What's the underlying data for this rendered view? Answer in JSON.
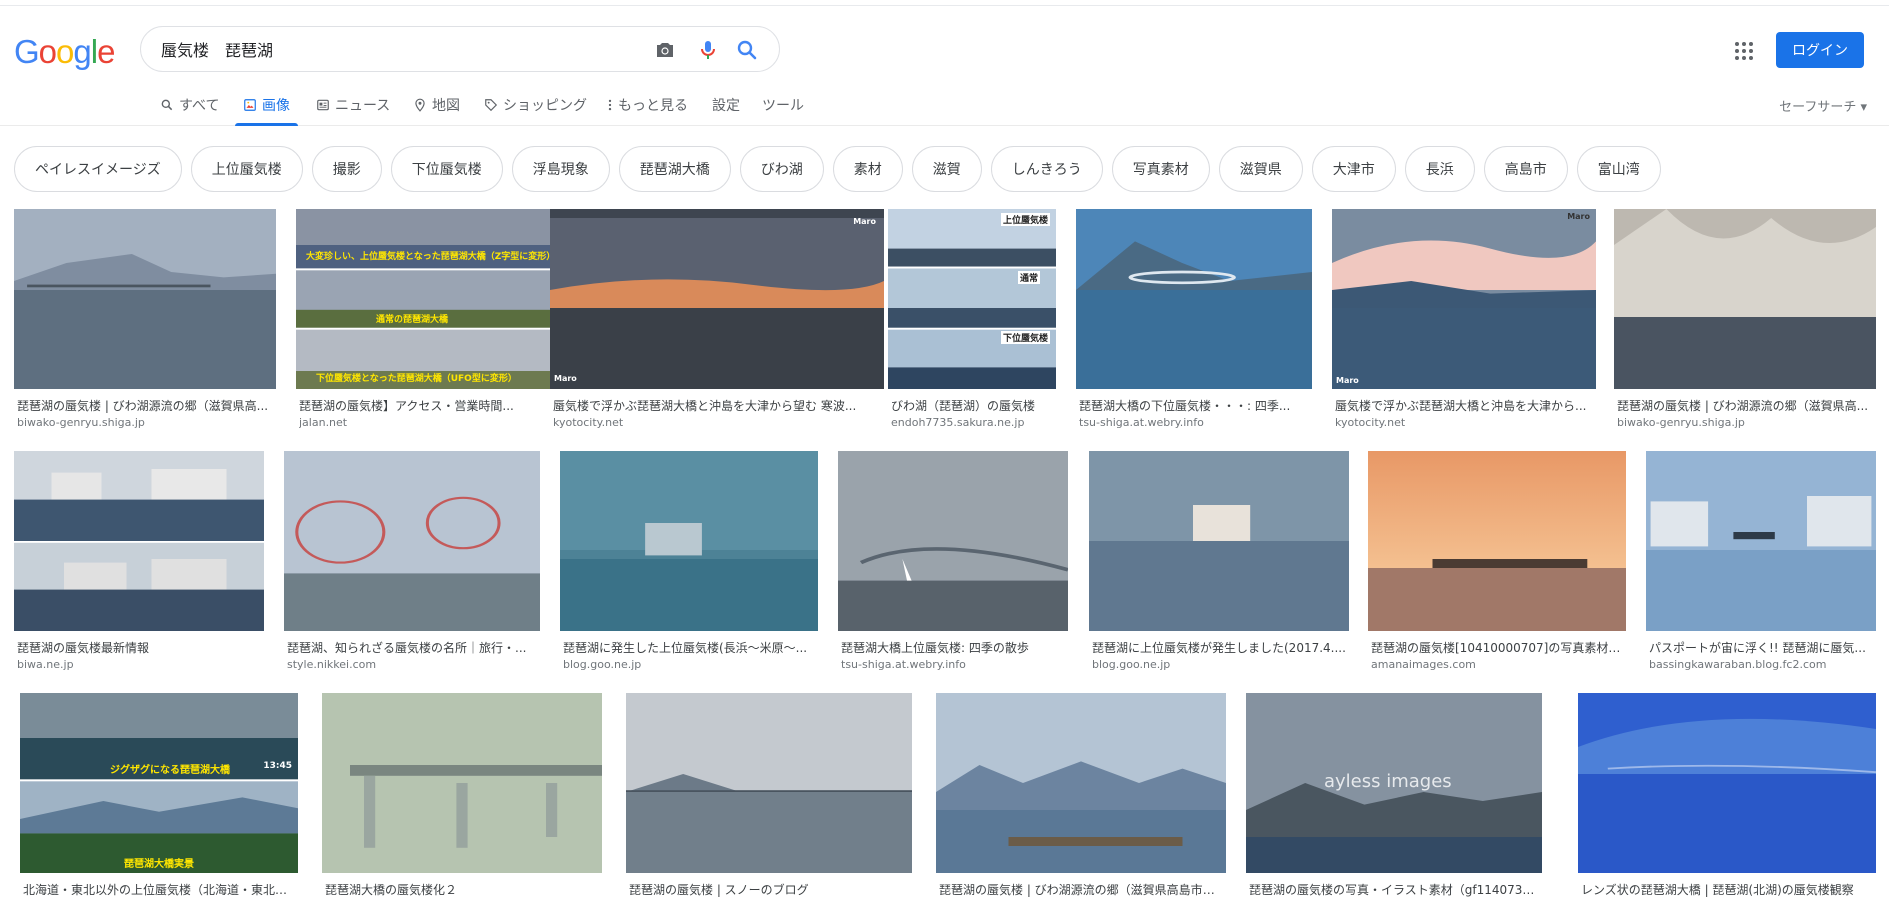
{
  "logo": "Google",
  "search": {
    "query": "蜃気楼　琵琶湖"
  },
  "header": {
    "login_label": "ログイン"
  },
  "tabs": [
    {
      "label": "すべて",
      "icon": "search-icon"
    },
    {
      "label": "画像",
      "icon": "image-icon",
      "active": true
    },
    {
      "label": "ニュース",
      "icon": "news-icon"
    },
    {
      "label": "地図",
      "icon": "map-pin-icon"
    },
    {
      "label": "ショッピング",
      "icon": "tag-icon"
    },
    {
      "label": "もっと見る",
      "icon": "more-vert-icon"
    },
    {
      "label": "設定"
    },
    {
      "label": "ツール"
    }
  ],
  "safesearch": "セーフサーチ ▾",
  "chips": [
    "ペイレスイメージズ",
    "上位蜃気楼",
    "撮影",
    "下位蜃気楼",
    "浮島現象",
    "琵琶湖大橋",
    "びわ湖",
    "素材",
    "滋賀",
    "しんきろう",
    "写真素材",
    "滋賀県",
    "大津市",
    "長浜",
    "高島市",
    "富山湾"
  ],
  "results": {
    "row1": [
      {
        "title": "琵琶湖の蜃気楼 | びわ湖源流の郷（滋賀県高...",
        "source": "biwako-genryu.shiga.jp",
        "overlays": []
      },
      {
        "title": "琵琶湖の蜃気楼】アクセス・営業時間...",
        "source": "jalan.net",
        "overlays": [
          "大変珍しい、上位蜃気楼となった琵琶湖大橋（Z字型に変形）",
          "通常の琵琶湖大橋",
          "下位蜃気楼となった琵琶湖大橋（UFO型に変形）"
        ]
      },
      {
        "title": "蜃気楼で浮かぶ琵琶湖大橋と沖島を大津から望む 寒波...",
        "source": "kyotocity.net",
        "overlays": [
          "Maro",
          "Maro"
        ]
      },
      {
        "title": "びわ湖（琵琶湖）の蜃気楼",
        "source": "endoh7735.sakura.ne.jp",
        "overlays": [
          "上位蜃気楼",
          "通常",
          "下位蜃気楼"
        ]
      },
      {
        "title": "琵琶湖大橋の下位蜃気楼・・・: 四季...",
        "source": "tsu-shiga.at.webry.info",
        "overlays": []
      },
      {
        "title": "蜃気楼で浮かぶ琵琶湖大橋と沖島を大津から...",
        "source": "kyotocity.net",
        "overlays": [
          "Maro",
          "Maro"
        ]
      },
      {
        "title": "琵琶湖の蜃気楼 | びわ湖源流の郷（滋賀県高...",
        "source": "biwako-genryu.shiga.jp",
        "overlays": []
      }
    ],
    "row2": [
      {
        "title": "琵琶湖の蜃気楼最新情報",
        "source": "biwa.ne.jp"
      },
      {
        "title": "琵琶湖、知られざる蜃気楼の名所｜旅行・...",
        "source": "style.nikkei.com"
      },
      {
        "title": "琵琶湖に発生した上位蜃気楼(長浜～米原～...",
        "source": "blog.goo.ne.jp"
      },
      {
        "title": "琵琶湖大橋上位蜃気楼: 四季の散歩",
        "source": "tsu-shiga.at.webry.info"
      },
      {
        "title": "琵琶湖に上位蜃気楼が発生しました(2017.4....",
        "source": "blog.goo.ne.jp"
      },
      {
        "title": "琵琶湖の蜃気楼[10410000707]の写真素材・...",
        "source": "amanaimages.com"
      },
      {
        "title": "パスポートが宙に浮く!! 琵琶湖に蜃気...",
        "source": "bassingkawaraban.blog.fc2.com"
      }
    ],
    "row3": [
      {
        "title": "北海道・東北以外の上位蜃気楼（北海道・東北蜃...",
        "overlays": [
          "ジグザグになる琵琶湖大橋",
          "13:45",
          "琵琶湖大橋実景"
        ]
      },
      {
        "title": "琵琶湖大橋の蜃気楼化２"
      },
      {
        "title": "琵琶湖の蜃気楼 | スノーのブログ"
      },
      {
        "title": "琵琶湖の蜃気楼 | びわ湖源流の郷（滋賀県高島市）..."
      },
      {
        "title": "琵琶湖の蜃気楼の写真・イラスト素材（gf11407348...",
        "overlays": [
          "ayless images"
        ]
      },
      {
        "title": "レンズ状の琵琶湖大橋 | 琵琶湖(北湖)の蜃気楼観察"
      }
    ]
  },
  "colors": {
    "accent": "#1a73e8",
    "blue": "#4285F4",
    "red": "#EA4335",
    "yellow": "#FBBC05",
    "green": "#34A853"
  }
}
